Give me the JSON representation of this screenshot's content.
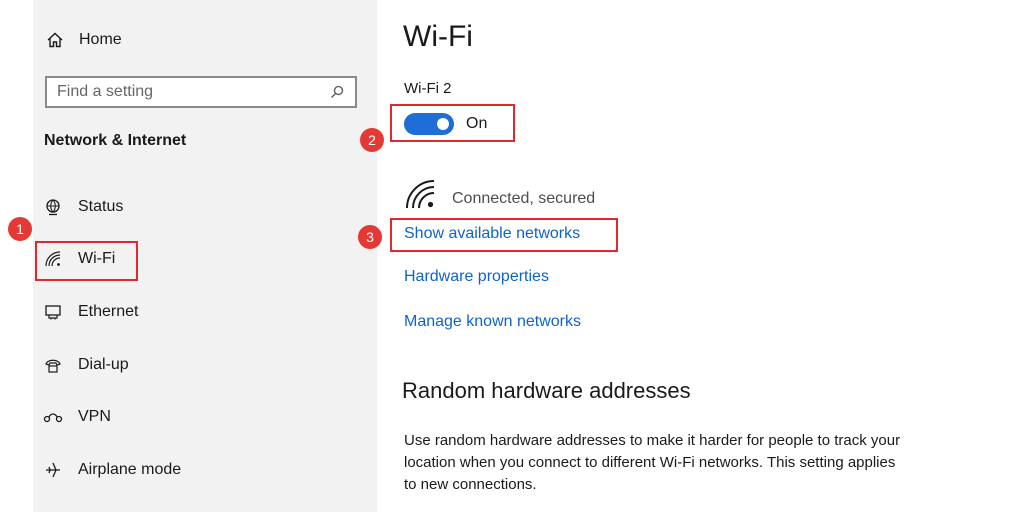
{
  "colors": {
    "accent": "#1e6ed8",
    "link": "#0f63c8",
    "highlight": "#e0282d",
    "badge": "#e53935",
    "sidebar_bg": "#f2f2f2"
  },
  "sidebar": {
    "home_label": "Home",
    "home_icon": "home-icon",
    "search_placeholder": "Find a setting",
    "search_icon": "search-icon",
    "section_title": "Network & Internet",
    "items": [
      {
        "label": "Status",
        "icon": "globe-icon"
      },
      {
        "label": "Wi-Fi",
        "icon": "wifi-icon",
        "selected": true
      },
      {
        "label": "Ethernet",
        "icon": "ethernet-icon"
      },
      {
        "label": "Dial-up",
        "icon": "dialup-icon"
      },
      {
        "label": "VPN",
        "icon": "vpn-icon"
      },
      {
        "label": "Airplane mode",
        "icon": "airplane-icon"
      }
    ]
  },
  "annotations": {
    "badge_1": "1",
    "badge_2": "2",
    "badge_3": "3"
  },
  "main": {
    "title": "Wi-Fi",
    "adapter_name": "Wi-Fi 2",
    "toggle": {
      "state": "On",
      "on": true
    },
    "connection_status": "Connected, secured",
    "links": {
      "show_available": "Show available networks",
      "hardware_properties": "Hardware properties",
      "manage_known": "Manage known networks"
    },
    "random_hw": {
      "heading": "Random hardware addresses",
      "description": "Use random hardware addresses to make it harder for people to track your location when you connect to different Wi-Fi networks. This setting applies to new connections."
    }
  }
}
